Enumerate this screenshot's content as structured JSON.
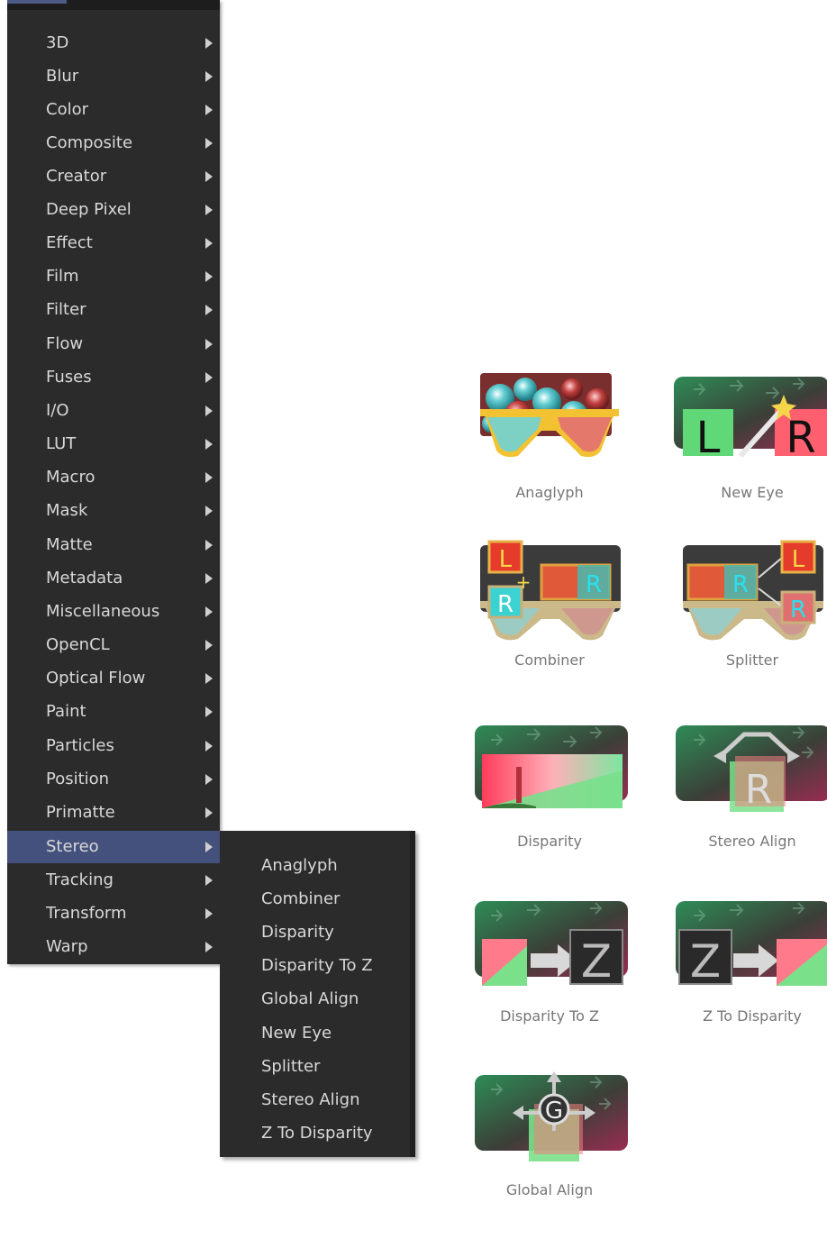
{
  "main_menu": {
    "items": [
      {
        "label": "3D"
      },
      {
        "label": "Blur"
      },
      {
        "label": "Color"
      },
      {
        "label": "Composite"
      },
      {
        "label": "Creator"
      },
      {
        "label": "Deep Pixel"
      },
      {
        "label": "Effect"
      },
      {
        "label": "Film"
      },
      {
        "label": "Filter"
      },
      {
        "label": "Flow"
      },
      {
        "label": "Fuses"
      },
      {
        "label": "I/O"
      },
      {
        "label": "LUT"
      },
      {
        "label": "Macro"
      },
      {
        "label": "Mask"
      },
      {
        "label": "Matte"
      },
      {
        "label": "Metadata"
      },
      {
        "label": "Miscellaneous"
      },
      {
        "label": "OpenCL"
      },
      {
        "label": "Optical Flow"
      },
      {
        "label": "Paint"
      },
      {
        "label": "Particles"
      },
      {
        "label": "Position"
      },
      {
        "label": "Primatte"
      },
      {
        "label": "Stereo",
        "active": true
      },
      {
        "label": "Tracking"
      },
      {
        "label": "Transform"
      },
      {
        "label": "Warp"
      }
    ]
  },
  "sub_menu": {
    "items": [
      {
        "label": "Anaglyph"
      },
      {
        "label": "Combiner"
      },
      {
        "label": "Disparity"
      },
      {
        "label": "Disparity To Z"
      },
      {
        "label": "Global Align"
      },
      {
        "label": "New Eye"
      },
      {
        "label": "Splitter"
      },
      {
        "label": "Stereo Align"
      },
      {
        "label": "Z To Disparity"
      }
    ]
  },
  "tools": [
    {
      "label": "Anaglyph",
      "icon": "anaglyph-glasses-icon"
    },
    {
      "label": "New Eye",
      "icon": "new-eye-icon"
    },
    {
      "label": "Combiner",
      "icon": "combiner-icon"
    },
    {
      "label": "Splitter",
      "icon": "splitter-icon"
    },
    {
      "label": "Disparity",
      "icon": "disparity-icon"
    },
    {
      "label": "Stereo Align",
      "icon": "stereo-align-icon"
    },
    {
      "label": "Disparity To Z",
      "icon": "disparity-to-z-icon"
    },
    {
      "label": "Z To Disparity",
      "icon": "z-to-disparity-icon"
    },
    {
      "label": "Global Align",
      "icon": "global-align-icon"
    }
  ],
  "icon_glyphs": {
    "left": "L",
    "right": "R",
    "z": "Z",
    "g": "G"
  },
  "colors": {
    "menu_bg": "#2b2b2b",
    "menu_highlight": "#45517d",
    "menu_text": "#d8d8d8",
    "caption_text": "#777777"
  }
}
